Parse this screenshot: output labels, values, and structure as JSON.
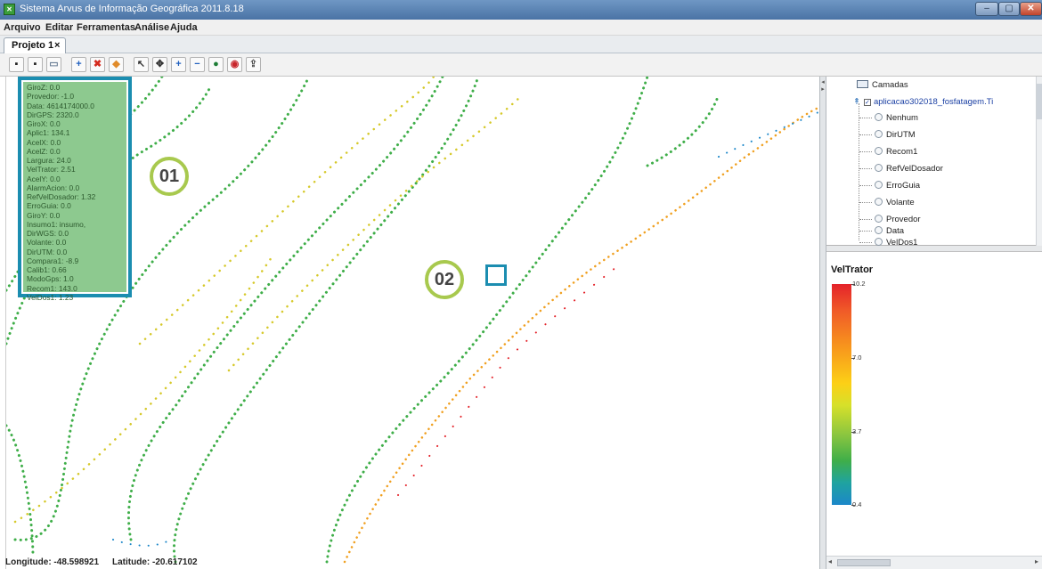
{
  "window": {
    "title": "Sistema Arvus de Informação Geográfica 2011.8.18",
    "controls": [
      "–",
      "▢",
      "✕"
    ]
  },
  "menu": [
    "Arquivo",
    "Editar",
    "Ferramentas",
    "Análise",
    "Ajuda"
  ],
  "tab": {
    "label": "Projeto 1",
    "close": "×"
  },
  "toolbar": {
    "buttons": [
      {
        "name": "save-icon",
        "glyph": "▪"
      },
      {
        "name": "save-as-icon",
        "glyph": "▪"
      },
      {
        "name": "print-icon",
        "glyph": "▭"
      },
      {
        "name": "add-layer-icon",
        "glyph": "+"
      },
      {
        "name": "remove-layer-icon",
        "glyph": "✖"
      },
      {
        "name": "layer-style-icon",
        "glyph": "◆"
      },
      {
        "name": "select-arrow-icon",
        "glyph": "↖"
      },
      {
        "name": "pan-icon",
        "glyph": "✥"
      },
      {
        "name": "zoom-in-icon",
        "glyph": "+"
      },
      {
        "name": "zoom-out-icon",
        "glyph": "−"
      },
      {
        "name": "info-icon",
        "glyph": "●"
      },
      {
        "name": "globe-icon",
        "glyph": "◉"
      },
      {
        "name": "export-icon",
        "glyph": "⇪"
      }
    ]
  },
  "info_panel": {
    "lines": [
      "GiroZ: 0.0",
      "Provedor: -1.0",
      "Data: 4614174000.0",
      "DirGPS: 2320.0",
      "GiroX: 0.0",
      "Aplic1: 134.1",
      "AcelX: 0.0",
      "AcelZ: 0.0",
      "Largura: 24.0",
      "VelTrator: 2.51",
      "AcelY: 0.0",
      "AlarmAcion: 0.0",
      "RefVelDosador: 1.32",
      "ErroGuia: 0.0",
      "GiroY: 0.0",
      "Insumo1: insumo,",
      "DirWGS: 0.0",
      "Volante: 0.0",
      "DirUTM: 0.0",
      "Compara1: -8.9",
      "Calib1: 0.66",
      "ModoGps: 1.0",
      "Recom1: 143.0",
      "VelDos1: 1.23"
    ]
  },
  "annotations": {
    "badge1": "01",
    "badge2": "02"
  },
  "status": {
    "longitude": "Longitude: -48.598921",
    "latitude": "Latitude: -20.617102"
  },
  "layers": {
    "root": "Camadas",
    "layer": "aplicacao302018_fosfatagem.Ti",
    "attributes": [
      "Nenhum",
      "DirUTM",
      "Recom1",
      "RefVelDosador",
      "ErroGuia",
      "Volante",
      "Provedor",
      "Data",
      "VelDos1"
    ]
  },
  "legend": {
    "title": "VelTrator",
    "ticks": [
      "10.2",
      "7.0",
      "3.7",
      "0.4"
    ],
    "colors": [
      "#e4232a",
      "#f7941d",
      "#fcd016",
      "#8cc63f",
      "#3fae49",
      "#1c87c9"
    ]
  }
}
